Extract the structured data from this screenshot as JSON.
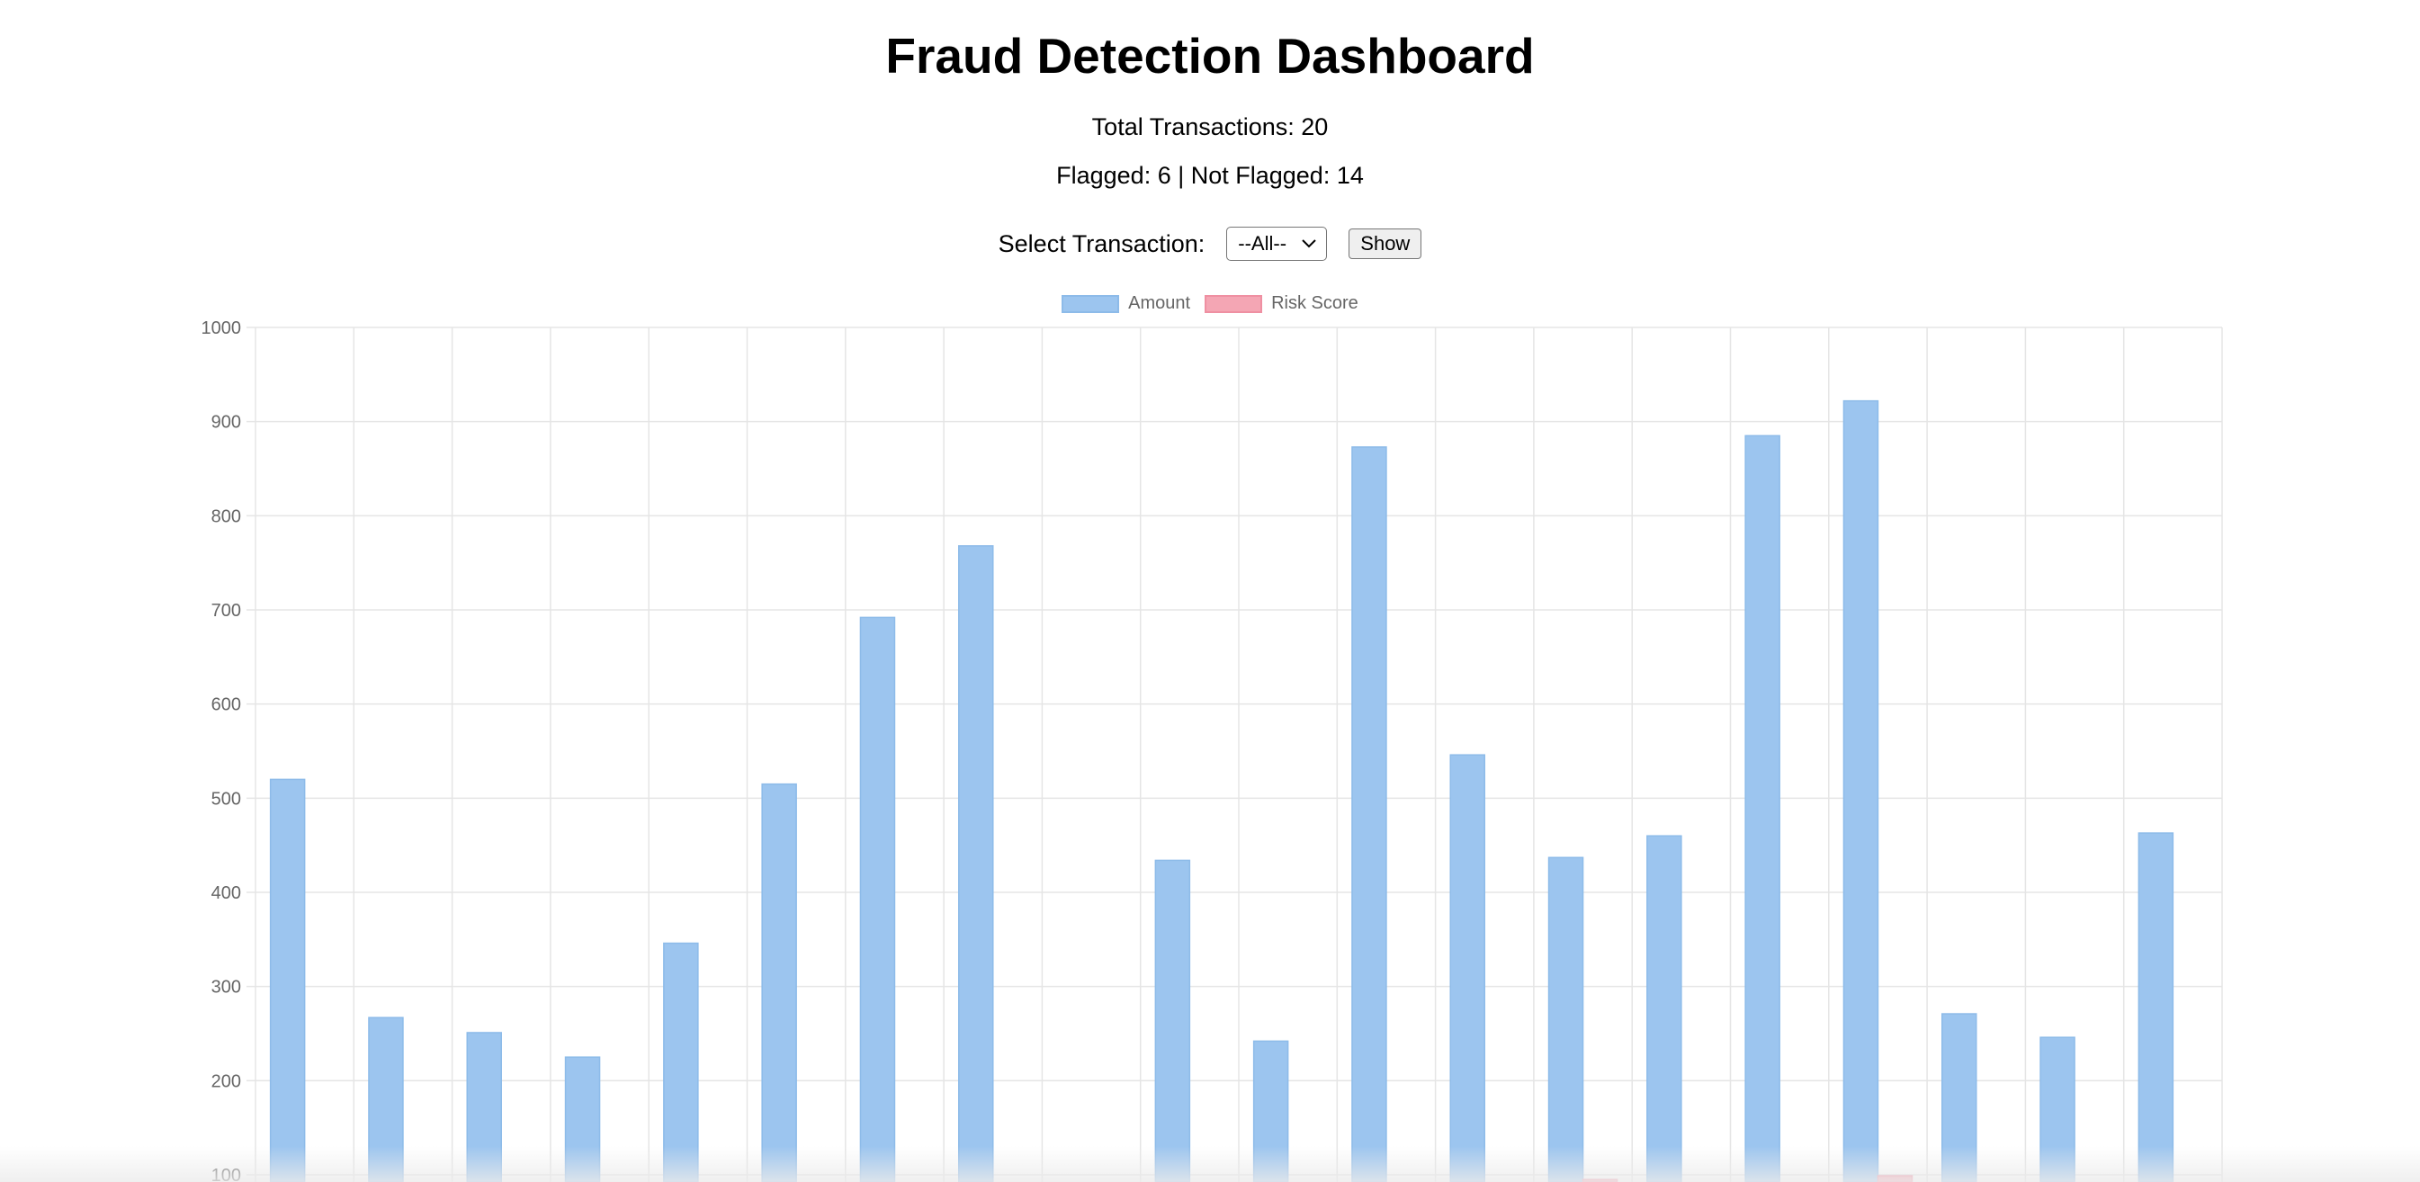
{
  "header": {
    "title": "Fraud Detection Dashboard",
    "total_text": "Total Transactions: 20",
    "flag_text": "Flagged: 6 | Not Flagged: 14"
  },
  "controls": {
    "select_label": "Select Transaction:",
    "select_value": "--All--",
    "show_label": "Show"
  },
  "colors": {
    "amount": "#9cc5ef",
    "amount_border": "#8dbbe9",
    "risk": "#f4a6b4",
    "risk_border": "#ef90a2",
    "grid": "#e5e5e5",
    "tick": "#666666"
  },
  "icons": {
    "select": "chevron-down-icon"
  },
  "chart_data": {
    "type": "bar",
    "legend_position": "top",
    "grid": true,
    "ylim": [
      100,
      1000
    ],
    "yticks": [
      100,
      200,
      300,
      400,
      500,
      600,
      700,
      800,
      900,
      1000
    ],
    "series": [
      {
        "name": "Amount",
        "values": [
          520,
          267,
          251,
          225,
          346,
          515,
          692,
          768,
          null,
          434,
          242,
          873,
          546,
          437,
          460,
          885,
          922,
          271,
          246,
          463
        ]
      },
      {
        "name": "Risk Score",
        "values": [
          null,
          null,
          null,
          null,
          null,
          null,
          null,
          null,
          null,
          null,
          null,
          null,
          null,
          95,
          null,
          null,
          99,
          null,
          null,
          null
        ]
      }
    ]
  }
}
